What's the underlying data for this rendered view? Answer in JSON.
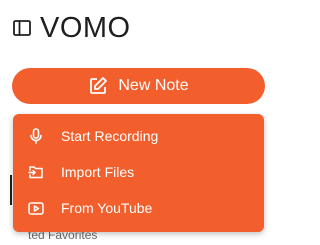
{
  "app": {
    "title": "VOMO"
  },
  "header": {
    "sidebar_icon": "sidebar-panel-icon"
  },
  "new_note": {
    "label": "New Note",
    "icon": "edit-note-icon"
  },
  "menu": {
    "items": [
      {
        "label": "Start Recording",
        "icon": "microphone-icon"
      },
      {
        "label": "Import Files",
        "icon": "folder-import-icon"
      },
      {
        "label": "From YouTube",
        "icon": "youtube-play-icon"
      }
    ]
  },
  "background": {
    "partial_text": "ted Favorites"
  },
  "colors": {
    "accent": "#f25f2c",
    "text": "#1f1f1f",
    "menu_text": "#ffffff"
  }
}
